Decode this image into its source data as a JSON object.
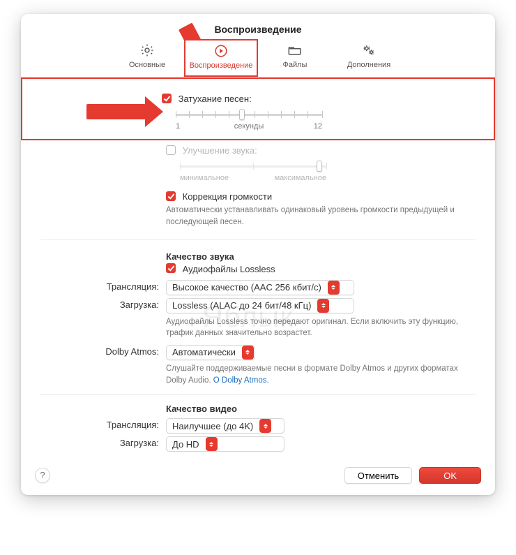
{
  "title": "Воспроизведение",
  "tabs": {
    "general": "Основные",
    "playback": "Воспроизведение",
    "files": "Файлы",
    "advanced": "Дополнения"
  },
  "crossfade": {
    "label": "Затухание песен:",
    "checked": true,
    "min": "1",
    "unit": "секунды",
    "max": "12"
  },
  "enhancer": {
    "label": "Улучшение звука:",
    "checked": false,
    "low": "минимальное",
    "high": "максимальное"
  },
  "soundcheck": {
    "label": "Коррекция громкости",
    "checked": true,
    "help": "Автоматически устанавливать одинаковый уровень громкости предыдущей и последующей песен."
  },
  "audio_quality": {
    "heading": "Качество звука",
    "lossless_label": "Аудиофайлы Lossless",
    "lossless_checked": true,
    "streaming_label": "Трансляция:",
    "streaming_value": "Высокое качество (AAC 256 кбит/с)",
    "download_label": "Загрузка:",
    "download_value": "Lossless (ALAC до 24 бит/48 кГц)",
    "help": "Аудиофайлы Lossless точно передают оригинал. Если включить эту функцию, трафик данных значительно возрастет."
  },
  "dolby": {
    "label": "Dolby Atmos:",
    "value": "Автоматически",
    "help": "Слушайте поддерживаемые песни в формате Dolby Atmos и других форматах Dolby Audio. ",
    "link": "О Dolby Atmos."
  },
  "video_quality": {
    "heading": "Качество видео",
    "streaming_label": "Трансляция:",
    "streaming_value": "Наилучшее (до 4K)",
    "download_label": "Загрузка:",
    "download_value": "До HD"
  },
  "buttons": {
    "help": "?",
    "cancel": "Отменить",
    "ok": "OK"
  },
  "watermark": "Яблык",
  "colors": {
    "accent": "#e43a2f"
  }
}
